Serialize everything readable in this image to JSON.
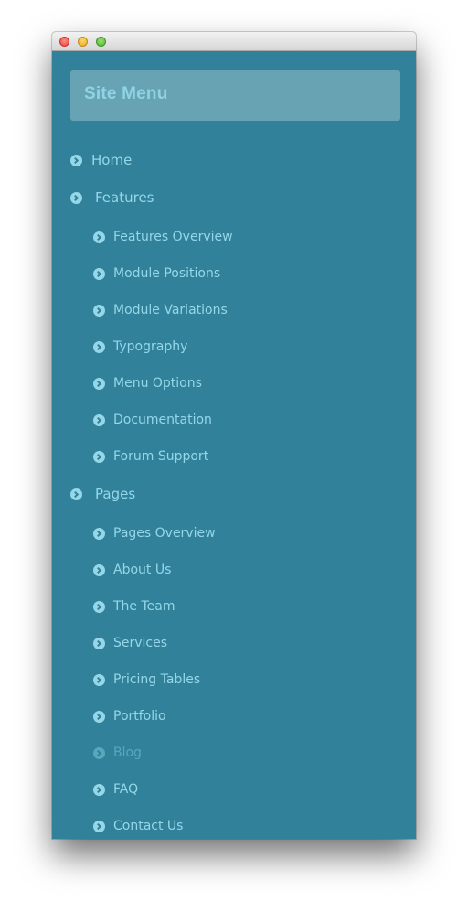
{
  "window": {
    "title_controls": [
      "close",
      "minimize",
      "zoom"
    ]
  },
  "menu": {
    "title": "Site Menu",
    "items": [
      {
        "label": "Home",
        "level": 1
      },
      {
        "label": "Features",
        "level": 1
      },
      {
        "label": "Features Overview",
        "level": 2
      },
      {
        "label": "Module Positions",
        "level": 2
      },
      {
        "label": "Module Variations",
        "level": 2
      },
      {
        "label": "Typography",
        "level": 2
      },
      {
        "label": "Menu Options",
        "level": 2
      },
      {
        "label": "Documentation",
        "level": 2
      },
      {
        "label": "Forum Support",
        "level": 2
      },
      {
        "label": "Pages",
        "level": 1
      },
      {
        "label": "Pages Overview",
        "level": 2
      },
      {
        "label": "About Us",
        "level": 2
      },
      {
        "label": "The Team",
        "level": 2
      },
      {
        "label": "Services",
        "level": 2
      },
      {
        "label": "Pricing Tables",
        "level": 2
      },
      {
        "label": "Portfolio",
        "level": 2
      },
      {
        "label": "Blog",
        "level": 2,
        "state": "active"
      },
      {
        "label": "FAQ",
        "level": 2
      },
      {
        "label": "Contact Us",
        "level": 2
      }
    ]
  },
  "colors": {
    "background": "#31819a",
    "header_bg": "#67a3b3",
    "title_text": "#8fd3e4",
    "item_text": "#95d7e8",
    "active_item_text": "#5aa7bc"
  },
  "icons": {
    "bullet": "chevron-circle-right-icon"
  }
}
